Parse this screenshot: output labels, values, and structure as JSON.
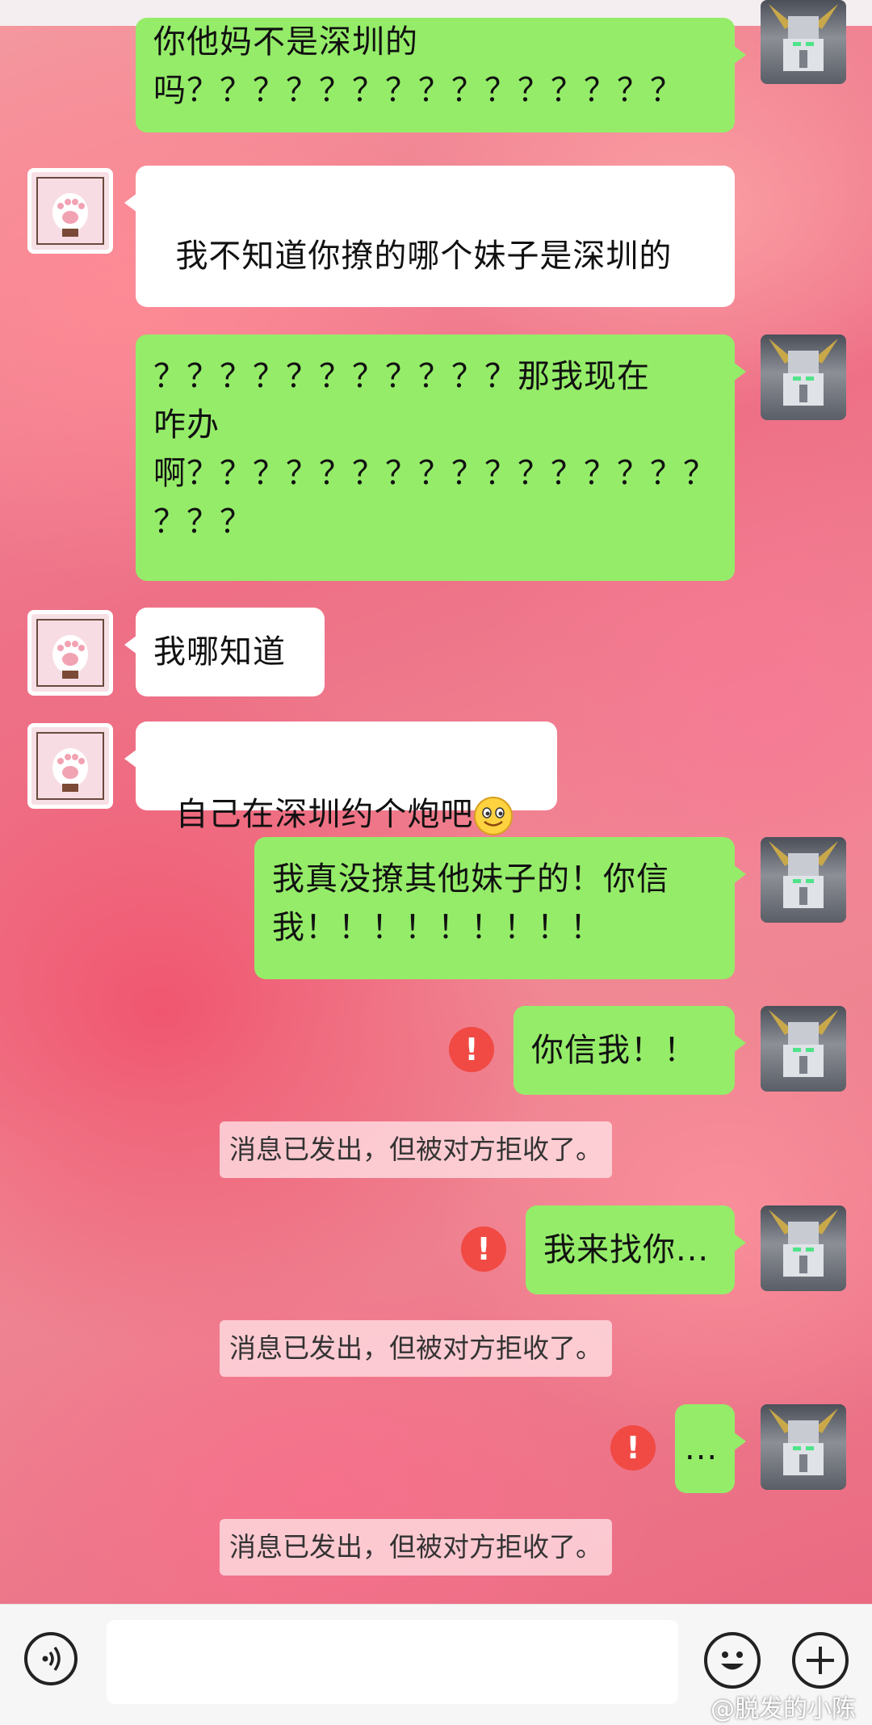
{
  "messages": [
    {
      "from": "me",
      "text": "你他妈不是深圳的\n吗？？？？？？？？？？？？？？？"
    },
    {
      "from": "them",
      "text": "我不知道你撩的哪个妹子是深圳的",
      "emoji": "smiley-emoji"
    },
    {
      "from": "me",
      "text": "？？？？？？？？？？？那我现在\n咋办\n啊？？？？？？？？？？？？？？？？\n？？？"
    },
    {
      "from": "them",
      "text": "我哪知道"
    },
    {
      "from": "them",
      "text": "自己在深圳约个炮吧",
      "emoji": "smiley-emoji"
    },
    {
      "from": "me",
      "text": "我真没撩其他妹子的！你信\n我！！！！！！！！！"
    },
    {
      "from": "me",
      "text": "你信我！！",
      "failed": true
    },
    {
      "from": "me",
      "text": "我来找你...",
      "failed": true
    },
    {
      "from": "me",
      "text": "...",
      "failed": true
    }
  ],
  "error_mark": "!",
  "notice_text": "消息已发出，但被对方拒收了。",
  "watermark": "@脱发的小陈",
  "colors": {
    "me_bubble": "#95ec69",
    "them_bubble": "#ffffff",
    "error": "#f14a44"
  },
  "icons": {
    "voice": "voice-icon",
    "emoji": "emoji-icon",
    "plus": "plus-icon",
    "error": "exclamation-icon"
  }
}
